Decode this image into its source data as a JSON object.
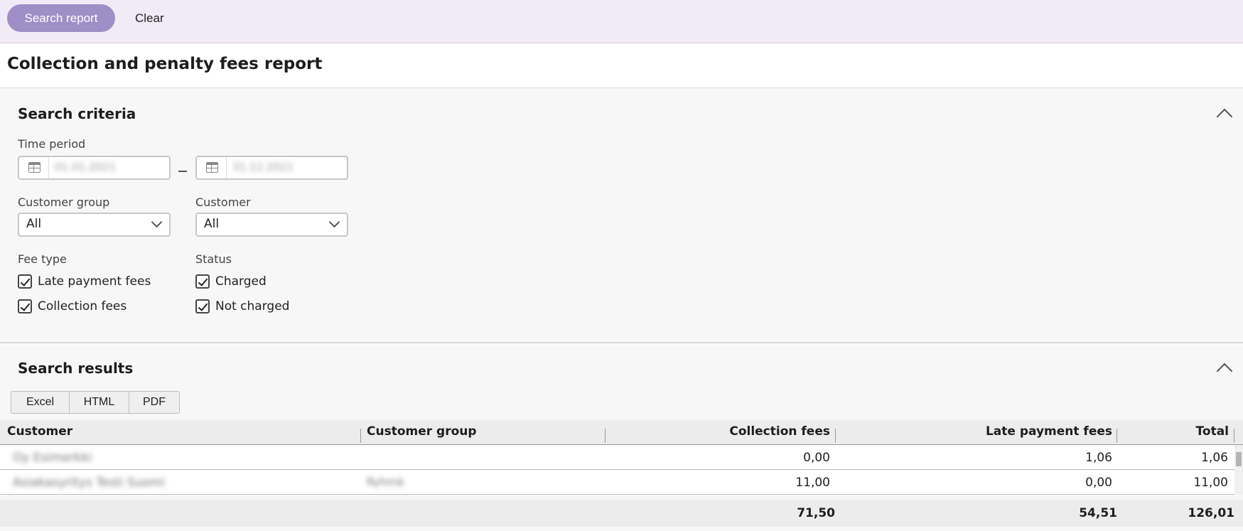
{
  "toolbar": {
    "search_label": "Search report",
    "clear_label": "Clear"
  },
  "page": {
    "title": "Collection and penalty fees report"
  },
  "criteria": {
    "title": "Search criteria",
    "time_period_label": "Time period",
    "date_from": "01.01.2021",
    "date_to": "31.12.2021",
    "customer_group_label": "Customer group",
    "customer_group_value": "All",
    "customer_label": "Customer",
    "customer_value": "All",
    "fee_type_label": "Fee type",
    "fee_types": [
      {
        "label": "Late payment fees",
        "checked": true
      },
      {
        "label": "Collection fees",
        "checked": true
      }
    ],
    "status_label": "Status",
    "statuses": [
      {
        "label": "Charged",
        "checked": true
      },
      {
        "label": "Not charged",
        "checked": true
      }
    ]
  },
  "results": {
    "title": "Search results",
    "export_buttons": [
      "Excel",
      "HTML",
      "PDF"
    ],
    "columns": [
      "Customer",
      "Customer group",
      "Collection fees",
      "Late payment fees",
      "Total"
    ],
    "rows": [
      {
        "customer": "Oy Esimerkki",
        "customer_group": "",
        "collection_fees": "0,00",
        "late_payment_fees": "1,06",
        "total": "1,06"
      },
      {
        "customer": "Asiakasyritys Testi Suomi",
        "customer_group": "Ryhmä",
        "collection_fees": "11,00",
        "late_payment_fees": "0,00",
        "total": "11,00"
      }
    ],
    "totals": {
      "collection_fees": "71,50",
      "late_payment_fees": "54,51",
      "total": "126,01"
    }
  }
}
